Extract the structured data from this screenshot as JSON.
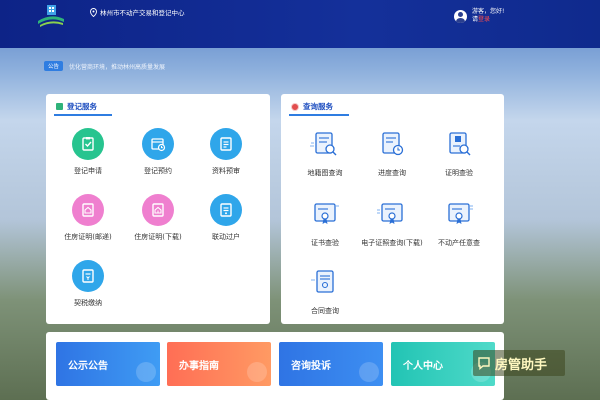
{
  "header": {
    "location": "林州市不动产交易和登记中心",
    "greeting": "游客，您好!",
    "login_prefix": "请",
    "login_link": "登录"
  },
  "notice": {
    "badge": "公告",
    "text": "优化营商环境，推动林州高质量发展"
  },
  "registration": {
    "title": "登记服务",
    "items": [
      {
        "label": "登记申请",
        "icon": "clipboard-edit-icon",
        "color": "#27c48f"
      },
      {
        "label": "登记预约",
        "icon": "calendar-clock-icon",
        "color": "#2fa6ea"
      },
      {
        "label": "资料预审",
        "icon": "document-review-icon",
        "color": "#2fa6ea"
      },
      {
        "label": "住房证明(邮递)",
        "icon": "house-certificate-mail-icon",
        "color": "#ef7fcf"
      },
      {
        "label": "住房证明(下载)",
        "icon": "house-certificate-download-icon",
        "color": "#ef7fcf"
      },
      {
        "label": "联动过户",
        "icon": "transfer-document-icon",
        "color": "#2fa6ea"
      },
      {
        "label": "契税缴纳",
        "icon": "tax-payment-icon",
        "color": "#2fa6ea"
      }
    ]
  },
  "query": {
    "title": "查询服务",
    "items": [
      {
        "label": "地籍图查询",
        "icon": "cadastral-map-search-icon"
      },
      {
        "label": "进度查询",
        "icon": "progress-clock-icon"
      },
      {
        "label": "证明查验",
        "icon": "certificate-verify-icon"
      },
      {
        "label": "证书查验",
        "icon": "certificate-check-icon"
      },
      {
        "label": "电子证照查询(下载)",
        "icon": "e-license-query-icon"
      },
      {
        "label": "不动产任意查",
        "icon": "property-query-icon"
      },
      {
        "label": "合同查询",
        "icon": "contract-query-icon"
      }
    ]
  },
  "cards": [
    {
      "label": "公示公告",
      "color": "#2f74e4"
    },
    {
      "label": "办事指南",
      "color": "#ff6e55"
    },
    {
      "label": "咨询投诉",
      "color": "#2f74e4"
    },
    {
      "label": "个人中心",
      "color": "#22c4b4"
    }
  ],
  "watermark": "房管助手"
}
